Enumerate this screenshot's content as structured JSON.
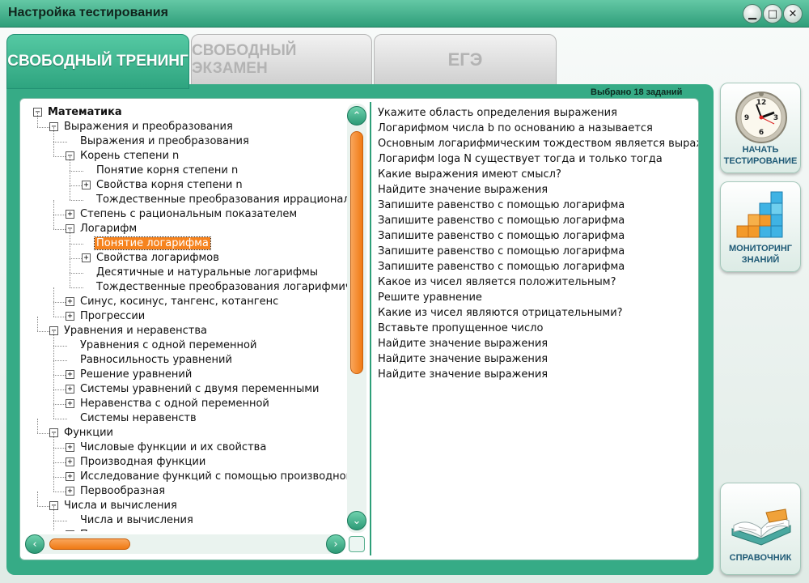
{
  "window": {
    "title": "Настройка тестирования",
    "controls": {
      "minimize": "▁",
      "maximize": "□",
      "close": "✕"
    }
  },
  "tabs": [
    {
      "label": "СВОБОДНЫЙ ТРЕНИНГ",
      "active": true
    },
    {
      "label": "СВОБОДНЫЙ ЭКЗАМЕН",
      "active": false
    },
    {
      "label": "ЕГЭ",
      "active": false
    }
  ],
  "selected_count": "Выбрано 18 заданий",
  "tree": [
    {
      "label": "Математика",
      "level": 0,
      "expander": "minus",
      "root": true
    },
    {
      "label": "Выражения и преобразования",
      "level": 1,
      "expander": "minus"
    },
    {
      "label": "Выражения и преобразования",
      "level": 2,
      "expander": "none"
    },
    {
      "label": "Корень степени n",
      "level": 2,
      "expander": "minus"
    },
    {
      "label": "Понятие корня степени n",
      "level": 3,
      "expander": "none"
    },
    {
      "label": "Свойства корня степени n",
      "level": 3,
      "expander": "plus"
    },
    {
      "label": "Тождественные преобразования иррациональных выражений",
      "level": 3,
      "expander": "none"
    },
    {
      "label": "Степень с рациональным показателем",
      "level": 2,
      "expander": "plus"
    },
    {
      "label": "Логарифм",
      "level": 2,
      "expander": "minus"
    },
    {
      "label": "Понятие логарифма",
      "level": 3,
      "expander": "none",
      "selected": true
    },
    {
      "label": "Свойства логарифмов",
      "level": 3,
      "expander": "plus"
    },
    {
      "label": "Десятичные и натуральные логарифмы",
      "level": 3,
      "expander": "none"
    },
    {
      "label": "Тождественные преобразования логарифмических выражений",
      "level": 3,
      "expander": "none"
    },
    {
      "label": "Синус, косинус, тангенс, котангенс",
      "level": 2,
      "expander": "plus"
    },
    {
      "label": "Прогрессии",
      "level": 2,
      "expander": "plus"
    },
    {
      "label": "Уравнения и неравенства",
      "level": 1,
      "expander": "minus"
    },
    {
      "label": "Уравнения с одной переменной",
      "level": 2,
      "expander": "none"
    },
    {
      "label": "Равносильность уравнений",
      "level": 2,
      "expander": "none"
    },
    {
      "label": "Решение уравнений",
      "level": 2,
      "expander": "plus"
    },
    {
      "label": "Системы уравнений с двумя переменными",
      "level": 2,
      "expander": "plus"
    },
    {
      "label": "Неравенства с одной переменной",
      "level": 2,
      "expander": "plus"
    },
    {
      "label": "Системы неравенств",
      "level": 2,
      "expander": "none"
    },
    {
      "label": "Функции",
      "level": 1,
      "expander": "minus"
    },
    {
      "label": "Числовые функции и их свойства",
      "level": 2,
      "expander": "plus"
    },
    {
      "label": "Производная функции",
      "level": 2,
      "expander": "plus"
    },
    {
      "label": "Исследование функций с помощью производной",
      "level": 2,
      "expander": "plus"
    },
    {
      "label": "Первообразная",
      "level": 2,
      "expander": "plus"
    },
    {
      "label": "Числа и вычисления",
      "level": 1,
      "expander": "minus"
    },
    {
      "label": "Числа и вычисления",
      "level": 2,
      "expander": "none"
    },
    {
      "label": "Проценты",
      "level": 2,
      "expander": "minus"
    }
  ],
  "tasks": [
    "Укажите область определения выражения",
    "Логарифмом числа b по основанию a называется",
    "Основным логарифмическим тождеством является выражение",
    "Логарифм loga N существует тогда и только тогда",
    "Какие выражения имеют смысл?",
    "Найдите значение выражения",
    "Запишите равенство с помощью логарифма",
    "Запишите равенство с помощью логарифма",
    "Запишите равенство с помощью логарифма",
    "Запишите равенство с помощью логарифма",
    "Запишите равенство с помощью логарифма",
    "Какое из чисел является положительным?",
    "Решите уравнение",
    "Какие из чисел являются отрицательными?",
    "Вставьте пропущенное число",
    "Найдите значение выражения",
    "Найдите значение выражения",
    "Найдите значение выражения"
  ],
  "scroll": {
    "up": "⌃",
    "down": "⌄",
    "left": "‹",
    "right": "›",
    "vertical_position": 0.0,
    "horizontal_position": 0.0
  },
  "side_buttons": {
    "start": {
      "label_line1": "НАЧАТЬ",
      "label_line2": "ТЕСТИРОВАНИЕ",
      "icon": "clock-icon",
      "clock_numerals": [
        "12",
        "3",
        "6",
        "9"
      ]
    },
    "monitor": {
      "label_line1": "МОНИТОРИНГ",
      "label_line2": "ЗНАНИЙ",
      "icon": "bar-blocks-icon"
    },
    "reference": {
      "label": "СПРАВОЧНИК",
      "icon": "open-book-icon"
    }
  },
  "colors": {
    "accent": "#36ab86",
    "selection": "#f6831e",
    "caption": "#1f5a76"
  }
}
